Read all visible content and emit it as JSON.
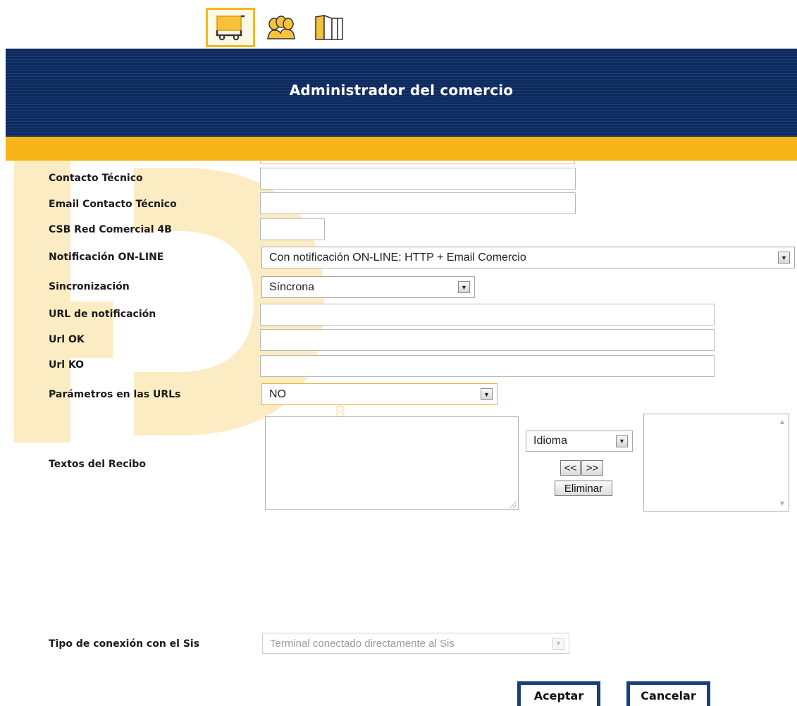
{
  "toolbar": {
    "icons": [
      "shopping-cart-icon",
      "users-icon",
      "book-icon"
    ]
  },
  "header": {
    "title": "Administrador del comercio"
  },
  "form": {
    "contacto_tecnico": {
      "label": "Contacto Técnico",
      "value": ""
    },
    "email_contacto_tecnico": {
      "label": "Email Contacto Técnico",
      "value": ""
    },
    "csb_red_comercial": {
      "label": "CSB Red Comercial 4B",
      "value": ""
    },
    "notificacion_online": {
      "label": "Notificación ON-LINE",
      "value": "Con notificación ON-LINE: HTTP + Email Comercio"
    },
    "sincronizacion": {
      "label": "Sincronización",
      "value": "Síncrona"
    },
    "url_notificacion": {
      "label": "URL de notificación",
      "value": ""
    },
    "url_ok": {
      "label": "Url OK",
      "value": ""
    },
    "url_ko": {
      "label": "Url KO",
      "value": ""
    },
    "parametros_urls": {
      "label": "Parámetros en las URLs",
      "value": "NO"
    },
    "textos_recibo": {
      "label": "Textos del Recibo",
      "idioma": "Idioma",
      "prev_label": "<<",
      "next_label": ">>",
      "eliminar_label": "Eliminar"
    },
    "tipo_conexion": {
      "label": "Tipo de conexión con el Sis",
      "value": "Terminal conectado directamente al Sis"
    }
  },
  "actions": {
    "aceptar": "Aceptar",
    "cancelar": "Cancelar"
  },
  "colors": {
    "header_navy": "#0e2a5c",
    "accent_gold": "#f8b51a",
    "button_border": "#16407a"
  }
}
